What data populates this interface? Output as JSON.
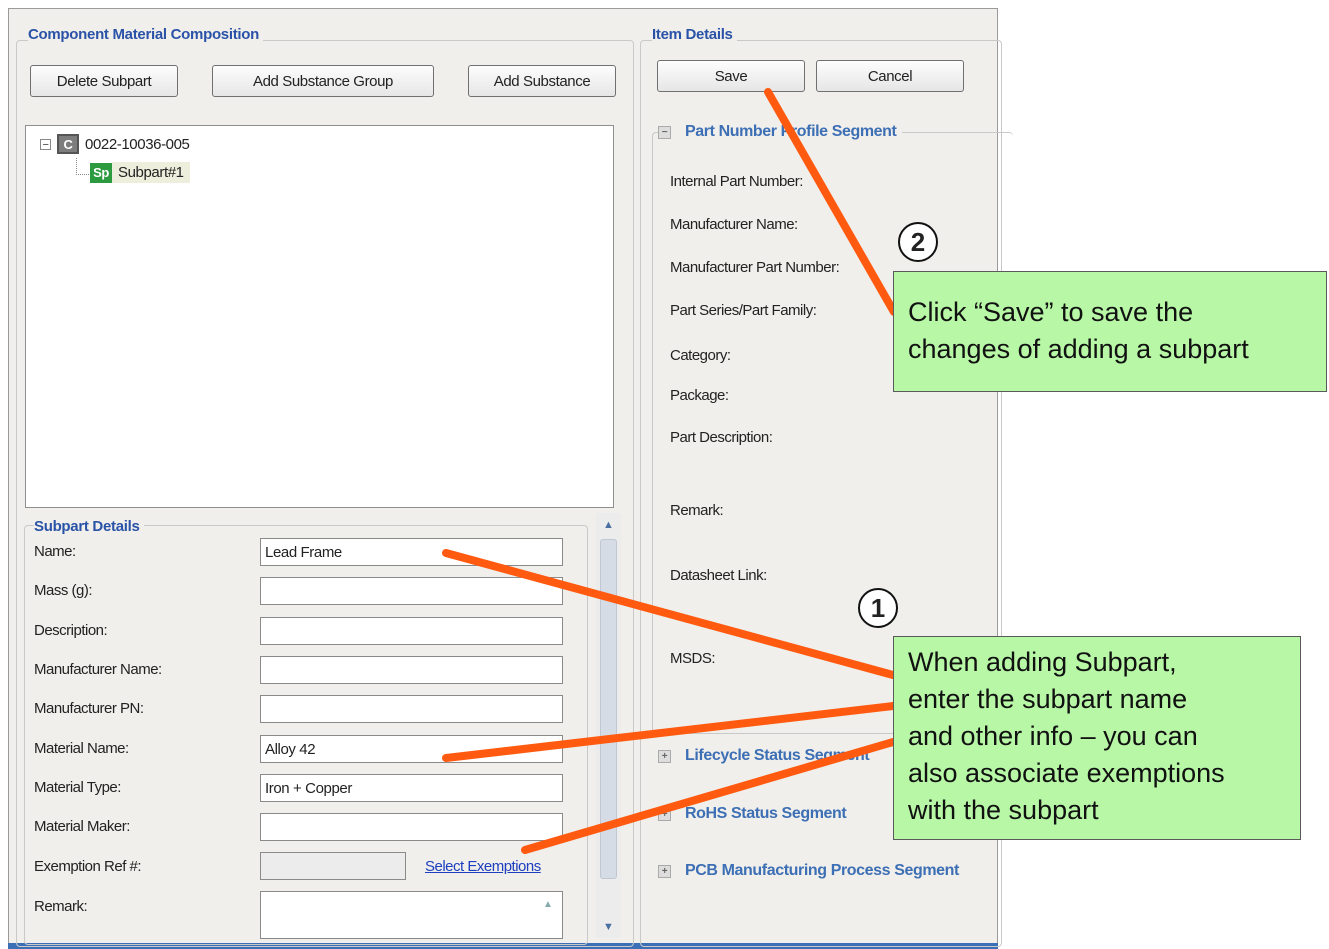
{
  "left_panel": {
    "title": "Component Material Composition",
    "buttons": {
      "delete_subpart": "Delete Subpart",
      "add_substance_group": "Add Substance Group",
      "add_substance": "Add Substance"
    },
    "tree": {
      "root": {
        "icon_letter": "C",
        "label": "0022-10036-005"
      },
      "child": {
        "icon_letter": "Sp",
        "label": "Subpart#1"
      }
    }
  },
  "subpart_details": {
    "title": "Subpart Details",
    "fields": [
      {
        "label": "Name:",
        "value": "Lead Frame"
      },
      {
        "label": "Mass (g):",
        "value": ""
      },
      {
        "label": "Description:",
        "value": ""
      },
      {
        "label": "Manufacturer Name:",
        "value": ""
      },
      {
        "label": "Manufacturer PN:",
        "value": ""
      },
      {
        "label": "Material Name:",
        "value": "Alloy 42"
      },
      {
        "label": "Material Type:",
        "value": "Iron + Copper"
      },
      {
        "label": "Material Maker:",
        "value": ""
      }
    ],
    "exemption": {
      "label": "Exemption Ref #:",
      "value": "",
      "link": "Select Exemptions"
    },
    "remark": {
      "label": "Remark:",
      "value": ""
    }
  },
  "item_details": {
    "title": "Item Details",
    "buttons": {
      "save": "Save",
      "cancel": "Cancel"
    },
    "segment_profile": "Part Number Profile Segment",
    "labels": [
      "Internal Part Number:",
      "Manufacturer Name:",
      "Manufacturer Part Number:",
      "Part Series/Part Family:",
      "Category:",
      "Package:",
      "Part Description:",
      "Remark:",
      "Datasheet Link:",
      "MSDS:"
    ],
    "segment_lifecycle": "Lifecycle Status Segment",
    "segment_rohs": "RoHS Status Segment",
    "segment_pcb": "PCB Manufacturing Process Segment"
  },
  "callouts": {
    "step1": {
      "number": "1",
      "lines": [
        "When adding Subpart,",
        "enter the subpart name",
        "and other info – you can",
        "also associate exemptions",
        "with the subpart"
      ]
    },
    "step2": {
      "number": "2",
      "lines": [
        "Click “Save” to save the",
        "changes of adding a subpart"
      ]
    }
  },
  "colors": {
    "callout_bg": "#b7f7a6",
    "arrow": "#ff5a10",
    "section_title": "#2a53a8"
  }
}
